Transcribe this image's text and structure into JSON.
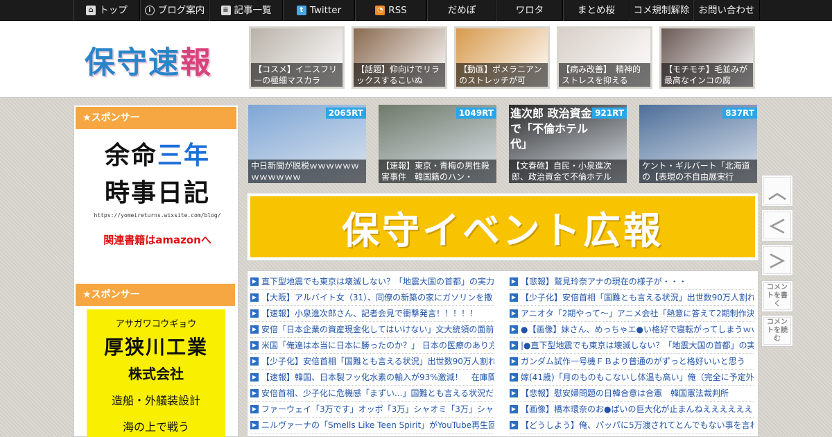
{
  "nav": {
    "items": [
      {
        "label": "トップ",
        "icon": "home-icon"
      },
      {
        "label": "ブログ案内",
        "icon": "info-icon"
      },
      {
        "label": "記事一覧",
        "icon": "list-icon"
      },
      {
        "label": "Twitter",
        "icon": "twitter-icon"
      },
      {
        "label": "RSS",
        "icon": "rss-icon"
      },
      {
        "label": "だめぽ"
      },
      {
        "label": "ワロタ"
      },
      {
        "label": "まとめ桜"
      },
      {
        "label": "コメ規制解除"
      },
      {
        "label": "お問い合わせ"
      }
    ]
  },
  "header": {
    "logo_a": "保守速",
    "logo_b": "報",
    "thumbs": [
      {
        "caption": "【コスメ】イニスフリーの極細マスカラ",
        "color": "#b9b2a9"
      },
      {
        "caption": "【話題】仰向けでリラックスするこいぬ",
        "color": "#8a6a50"
      },
      {
        "caption": "【動画】ポメラニアンのストレッチが可",
        "color": "#d79a4d"
      },
      {
        "caption": "【病み改善】　精神的ストレスを抑える",
        "color": "#d8cfc8"
      },
      {
        "caption": "【モチモチ】毛並みが最高なインコの腐",
        "color": "#6b5a55"
      }
    ]
  },
  "sidebar": {
    "head1": "★スポンサー",
    "ad1": {
      "a": "余命",
      "b": "三年",
      "c": "時事日記",
      "url": "https://yomeireturns.wixsite.com/blog/",
      "amazon": "関連書籍はamazonへ"
    },
    "head2": "★スポンサー",
    "ad2": {
      "kana": "アサガワコウギョウ",
      "name": "厚狭川工業",
      "co": "株式会社",
      "desc": "造船・外艤装設計",
      "tag": "海の上で戦う"
    }
  },
  "rt": [
    {
      "count": "2065RT",
      "caption": "中日新聞が脱税ｗｗｗｗｗｗｗｗｗｗｗｗ",
      "color": "#7ea6d6"
    },
    {
      "count": "1049RT",
      "caption": "【速報】東京・青梅の男性殺害事件　韓国籍のハン・",
      "color": "#6f7a6a"
    },
    {
      "count": "921RT",
      "caption": "【文春砲】自民・小泉進次郎、政治資金で不倫ホテル",
      "color": "#2a2a2a"
    },
    {
      "count": "837RT",
      "caption": "ケント・ギルバート「北海道の【表現の不自由展実行",
      "color": "#4e6f9a"
    }
  ],
  "rt3_overlay": "進次郎 政治資金で「不倫ホテル代」",
  "banner": "保守イベント広報",
  "list_left": [
    "直下型地震でも東京は壊滅しない？「地震大国の首都」の実力",
    "【大阪】アルバイト女（31）、同僚の新築の家にガソリンを撒",
    "【速報】小泉進次郎さん、記者会見で衝撃発言！！！！！",
    "安倍「日本企業の資産現金化してはいけない」文大統領の面前",
    "米国「俺達は本当に日本に勝ったのか？」 日本の医療のあり方",
    "【少子化】安倍首相「国難とも言える状況」出世数90万人割れ",
    "【速報】韓国、日本製フッ化水素の輸入が93%激減！　在庫間",
    "安倍首相、少子化に危機感「まずい...」国難とも言える状況だ",
    "ファーウェイ「3万です」オッポ「3万」シャオミ「3万」シャー",
    "ニルヴァーナの「Smells Like Teen Spirit」がYouTube再生回数10"
  ],
  "list_right": [
    "【悲報】鷲見玲奈アナの現在の様子が・・・",
    "【少子化】安倍首相「国難とも言える状況」出世数90万人割れ",
    "アニオタ「2期やって～」アニメ会社「熱意に答えて2期制作決",
    "●【画像】妹さん、めっちゃエ●い格好で寝転がってしまうｗｗ",
    "|●直下型地震でも東京は壊滅しない？「地震大国の首都」の実",
    "ガンダム試作一号機ＦＢより普通のがずっと格好いいと思う",
    "嫁(41歳)「月のものもこないし体温も高い」俺（完全に予定外",
    "【悲報】慰安婦問題の日韓合意は合憲　韓国憲法裁判所",
    "【画像】橋本環奈のお●ぱいの巨大化が止まんねえええええええ",
    "【どうしよう】俺、パッパに5万渡されてとんでもない事を言わ"
  ],
  "float": {
    "up": "︿",
    "back": "＜",
    "fwd": "＞",
    "write": "コメントを書く",
    "read": "コメントを読む"
  }
}
